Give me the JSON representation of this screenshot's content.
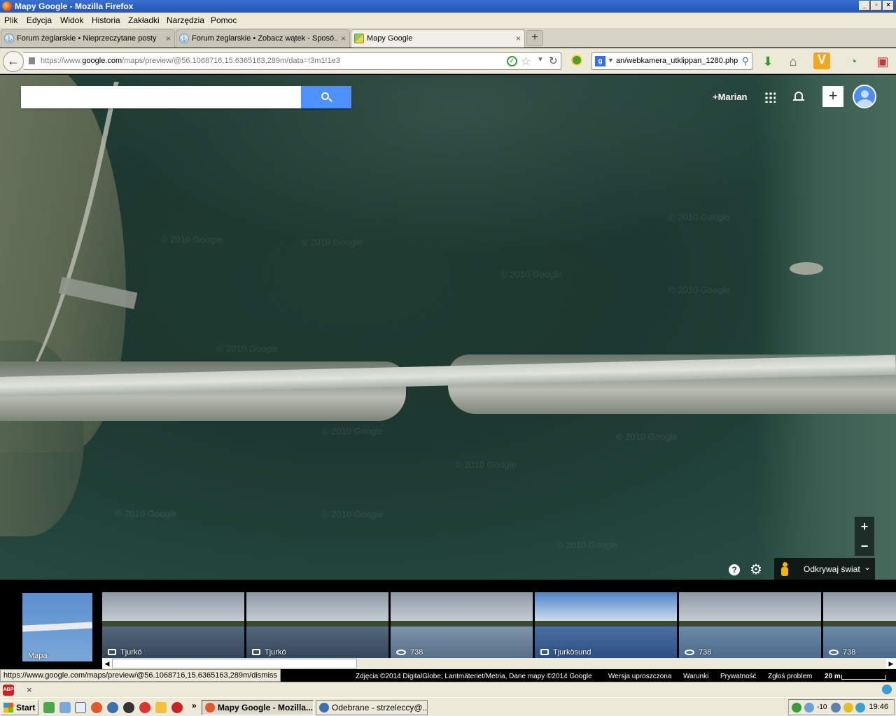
{
  "window": {
    "title": "Mapy Google - Mozilla Firefox",
    "controls": [
      "_",
      "▫",
      "×"
    ]
  },
  "menu": [
    "Plik",
    "Edycja",
    "Widok",
    "Historia",
    "Zakładki",
    "Narzędzia",
    "Pomoc"
  ],
  "tabs": [
    {
      "label": "Forum żeglarskie • Nieprzeczytane posty",
      "active": false
    },
    {
      "label": "Forum żeglarskie • Zobacz wątek - Sposó...",
      "active": false
    },
    {
      "label": "Mapy Google",
      "active": true
    }
  ],
  "tab_close": "×",
  "newtab": "+",
  "nav": {
    "back": "←",
    "url_prefix": "https://www.",
    "url_domain": "google.com",
    "url_rest": "/maps/preview/@56.1068716,15.6365163,289m/data=!3m1!1e3",
    "search_text": "an/webkamera_utklippan_1280.php"
  },
  "maps": {
    "search_placeholder": "",
    "user": "+Marian",
    "plus": "+",
    "zoom_in": "+",
    "zoom_out": "−",
    "help": "?",
    "explore": "Odkrywaj świat",
    "explore_chevron": "»",
    "watermark": "© 2010 Google"
  },
  "filmstrip": {
    "map_label": "Mapa",
    "photos": [
      {
        "label": "Tjurkö",
        "kind": "photo"
      },
      {
        "label": "Tjurkö",
        "kind": "photo"
      },
      {
        "label": "738",
        "kind": "pano"
      },
      {
        "label": "Tjurkösund",
        "kind": "photo"
      },
      {
        "label": "738",
        "kind": "pano"
      },
      {
        "label": "738",
        "kind": "pano"
      }
    ]
  },
  "status": {
    "hover_url": "https://www.google.com/maps/preview/@56.1068716,15.6365163,289m/dismiss",
    "attribution": "Zdjęcia ©2014 DigitalGlobe, Lantmäteriet/Metria, Dane mapy ©2014 Google",
    "simplified": "Wersja uproszczona",
    "terms": "Warunki",
    "privacy": "Prywatność",
    "report": "Zgłoś problem",
    "scale": "20 m"
  },
  "addonbar": {
    "close": "×",
    "abp": "ABP"
  },
  "taskbar": {
    "start": "Start",
    "more": "»",
    "buttons": [
      {
        "label": "Mapy Google - Mozilla...",
        "active": true
      },
      {
        "label": "Odebrane - strzeleccy@...",
        "active": false
      }
    ],
    "temp": "-10",
    "clock": "19:46"
  },
  "colors": {
    "search_button": "#4d90fe",
    "titlebar": "#2456b8",
    "water": "#1d3830"
  }
}
